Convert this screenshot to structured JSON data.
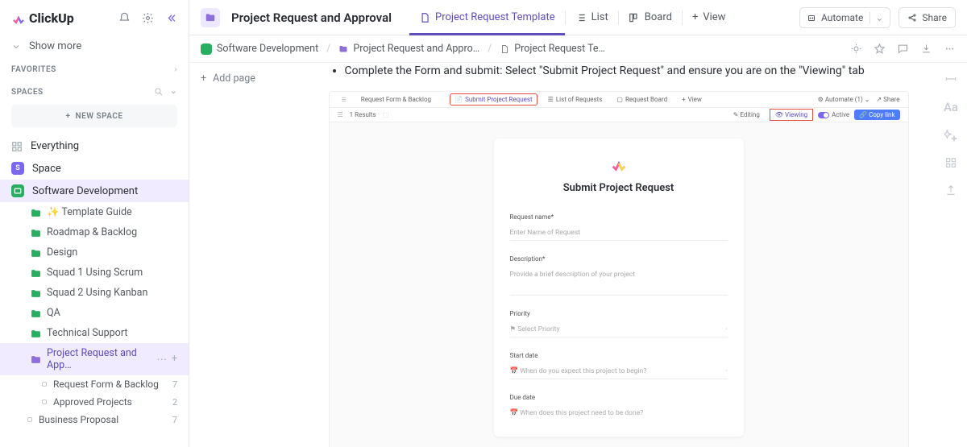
{
  "sidebar": {
    "show_more": "Show more",
    "favorites_label": "FAVORITES",
    "spaces_label": "SPACES",
    "new_space": "NEW SPACE",
    "everything": "Everything",
    "space": "Space",
    "software_dev": "Software Development",
    "folders": [
      {
        "label": "✨ Template Guide",
        "color": "#27ae60"
      },
      {
        "label": "Roadmap & Backlog",
        "color": "#27ae60"
      },
      {
        "label": "Design",
        "color": "#27ae60"
      },
      {
        "label": "Squad 1 Using Scrum",
        "color": "#27ae60"
      },
      {
        "label": "Squad 2 Using Kanban",
        "color": "#27ae60"
      },
      {
        "label": "QA",
        "color": "#27ae60"
      },
      {
        "label": "Technical Support",
        "color": "#27ae60"
      },
      {
        "label": "Project Request and App…",
        "color": "#8e6fd8",
        "selected": true
      }
    ],
    "subs": [
      {
        "label": "Request Form & Backlog",
        "count": "7"
      },
      {
        "label": "Approved Projects",
        "count": "2"
      }
    ],
    "biz_proposal": {
      "label": "Business Proposal",
      "count": "7"
    }
  },
  "topbar": {
    "title": "Project Request and Approval",
    "tabs": {
      "template": "Project Request Template",
      "list": "List",
      "board": "Board",
      "view": "View"
    },
    "automate": "Automate",
    "share": "Share"
  },
  "crumbs": {
    "c1": "Software Development",
    "c2": "Project Request and Appro…",
    "c3": "Project Request Te…"
  },
  "doc": {
    "add_page": "Add page",
    "bullet": "Complete the Form and submit: Select \"Submit Project Request\" and ensure you are on the \"Viewing\" tab"
  },
  "screenshot": {
    "nav": {
      "form_backlog": "Request Form & Backlog",
      "submit": "Submit Project Request",
      "list": "List of Requests",
      "board": "Request Board",
      "view": "View",
      "automate": "Automate (1)",
      "share": "Share"
    },
    "sub": {
      "results": "1 Results",
      "editing": "Editing",
      "viewing": "Viewing",
      "active": "Active",
      "copy": "Copy link"
    },
    "form": {
      "title": "Submit Project Request",
      "request_name_label": "Request name*",
      "request_name_ph": "Enter Name of Request",
      "desc_label": "Description*",
      "desc_ph": "Provide a brief description of your project",
      "priority_label": "Priority",
      "priority_ph": "Select Priority",
      "start_label": "Start date",
      "start_ph": "When do you expect this project to begin?",
      "due_label": "Due date",
      "due_ph": "When does this project need to be done?"
    }
  }
}
